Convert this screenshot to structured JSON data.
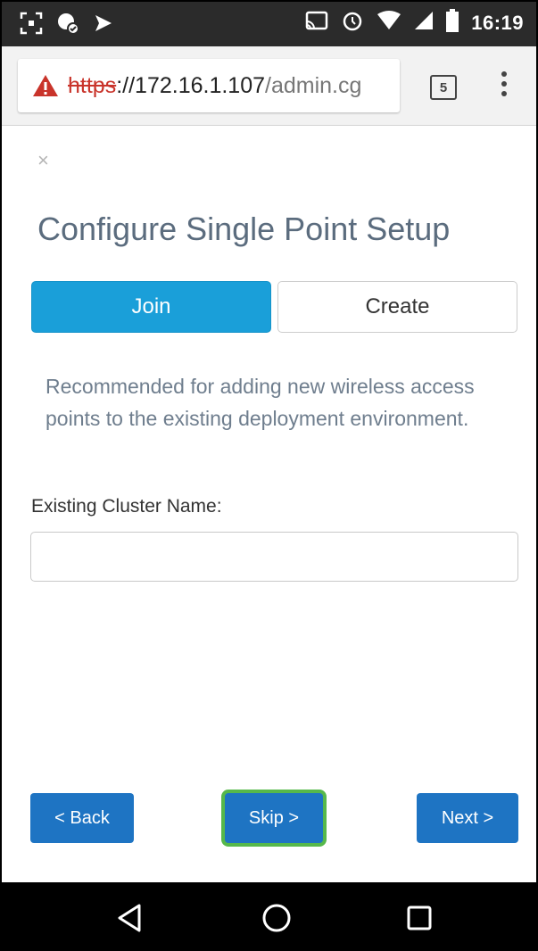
{
  "status_bar": {
    "time": "16:19",
    "icons_left": [
      "screenshot-icon",
      "vpn-key-icon",
      "signal-check-icon"
    ],
    "icons_right": [
      "cast-icon",
      "alarm-icon",
      "wifi-icon",
      "cell-signal-icon",
      "battery-icon"
    ]
  },
  "browser": {
    "url_scheme": "https",
    "url_host": "://172.16.1.107",
    "url_path": "/admin.cg",
    "tab_count": "5",
    "warning_color": "#c9342b"
  },
  "page": {
    "close_label": "×",
    "title": "Configure Single Point Setup",
    "toggle": {
      "join_label": "Join",
      "create_label": "Create",
      "selected": "Join"
    },
    "description": "Recommended for adding new wireless access points to the existing deployment environment.",
    "cluster_label": "Existing Cluster Name:",
    "cluster_value": "",
    "back_label": "< Back",
    "skip_label": "Skip >",
    "next_label": "Next >"
  },
  "colors": {
    "primary": "#1a9fd9",
    "nav_button": "#1e74c3",
    "highlight": "#56b84b",
    "title_text": "#5b6c7e"
  },
  "navigation": {
    "buttons": [
      "back-triangle-icon",
      "home-circle-icon",
      "recents-square-icon"
    ]
  }
}
